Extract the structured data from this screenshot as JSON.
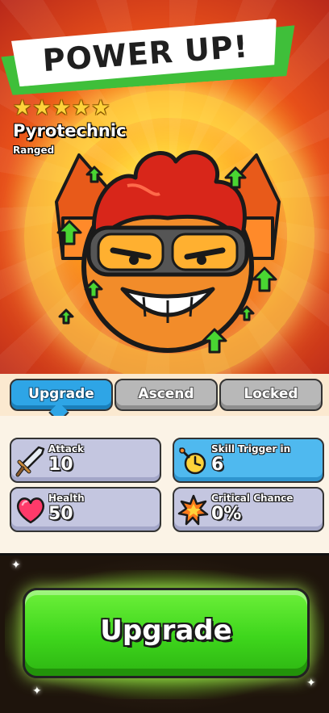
{
  "screen": {
    "title": "POWER UP!"
  },
  "hero": {
    "stars": [
      "★",
      "★",
      "★",
      "★",
      "★"
    ],
    "name": "Pyrotechnic",
    "type": "Ranged"
  },
  "tabs": [
    {
      "label": "Upgrade",
      "active": true
    },
    {
      "label": "Ascend",
      "active": false
    },
    {
      "label": "Locked",
      "active": false
    }
  ],
  "stats": {
    "attack": {
      "label": "Attack",
      "value": "10",
      "icon": "sword-icon"
    },
    "skill_trigger": {
      "label": "Skill Trigger in",
      "value": "6",
      "icon": "timer-bomb-icon"
    },
    "health": {
      "label": "Health",
      "value": "50",
      "icon": "heart-icon"
    },
    "critical": {
      "label": "Critical Chance",
      "value": "0%",
      "icon": "critical-burst-icon"
    }
  },
  "actions": {
    "upgrade_label": "Upgrade"
  },
  "colors": {
    "banner_green": "#3fbf3a",
    "tab_active": "#2ea5e6",
    "tab_inactive": "#b8b8b8",
    "stat_gray": "#c4c6e0",
    "stat_blue": "#4fb9ef",
    "button_green": "#3ed61c"
  }
}
